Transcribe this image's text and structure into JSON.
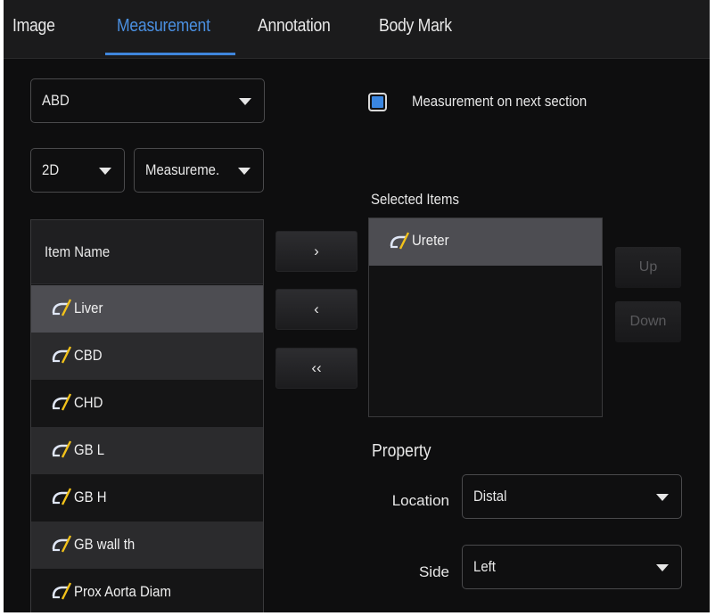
{
  "tabs": [
    {
      "label": "Image",
      "active": false
    },
    {
      "label": "Measurement",
      "active": true
    },
    {
      "label": "Annotation",
      "active": false
    },
    {
      "label": "Body Mark",
      "active": false
    }
  ],
  "exam_select": {
    "value": "ABD"
  },
  "mode_select": {
    "value": "2D"
  },
  "type_select": {
    "value": "Measureme."
  },
  "next_section": {
    "label": "Measurement on next section",
    "checked": true
  },
  "item_list": {
    "header": "Item Name",
    "items": [
      {
        "label": "Liver",
        "selected": true
      },
      {
        "label": "CBD",
        "selected": false
      },
      {
        "label": "CHD",
        "selected": false
      },
      {
        "label": "GB L",
        "selected": false
      },
      {
        "label": "GB H",
        "selected": false
      },
      {
        "label": "GB wall th",
        "selected": false
      },
      {
        "label": "Prox Aorta Diam",
        "selected": false
      }
    ]
  },
  "transfer_buttons": {
    "add": "›",
    "remove": "‹",
    "remove_all": "‹‹"
  },
  "selected_items": {
    "label": "Selected Items",
    "items": [
      {
        "label": "Ureter",
        "selected": true
      }
    ]
  },
  "order_buttons": {
    "up": "Up",
    "down": "Down"
  },
  "property": {
    "title": "Property",
    "location": {
      "label": "Location",
      "value": "Distal"
    },
    "side": {
      "label": "Side",
      "value": "Left"
    }
  },
  "colors": {
    "accent": "#3f86dc",
    "background": "#0e0e0f",
    "selected_row": "#4d4d52"
  },
  "icons": {
    "measure_item": "caliper-ruler-icon"
  }
}
